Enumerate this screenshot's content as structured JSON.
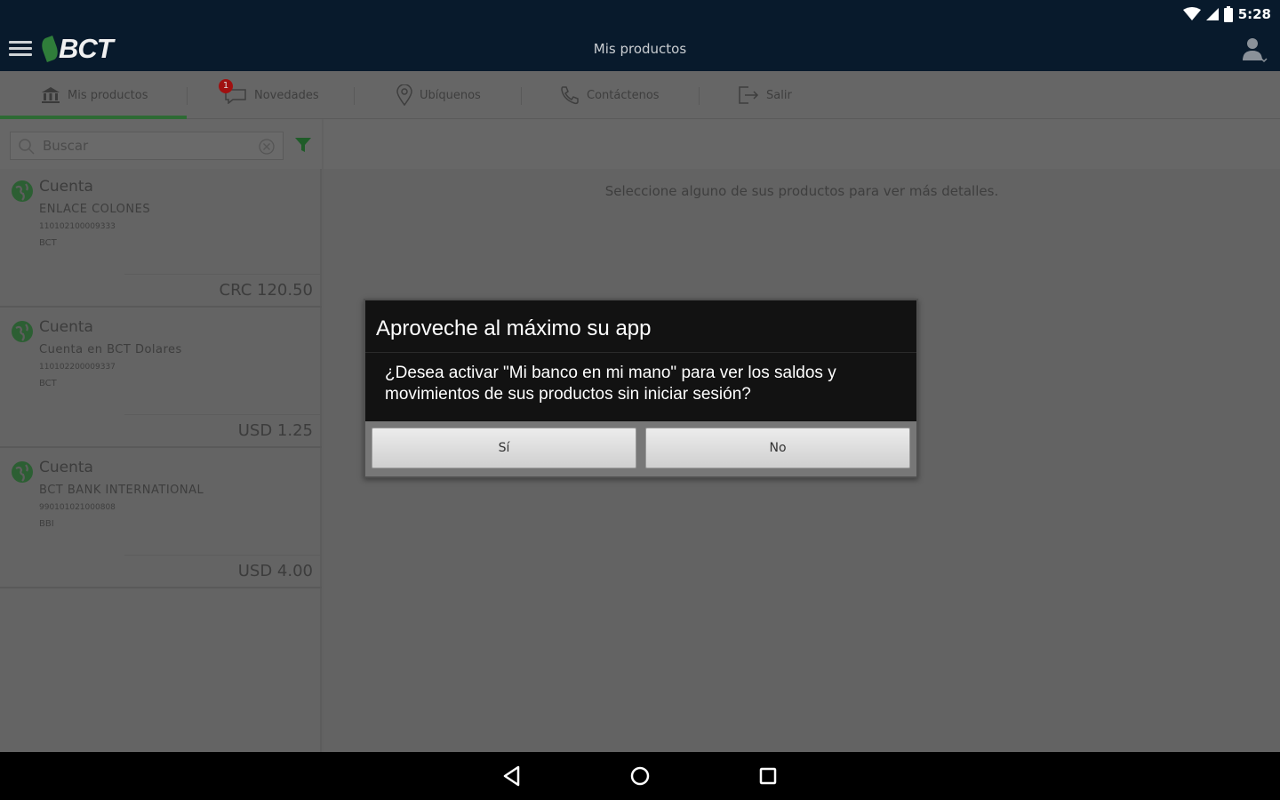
{
  "status_bar": {
    "time": "5:28"
  },
  "app_bar": {
    "logo_text": "BCT",
    "title": "Mis productos"
  },
  "tabs": [
    {
      "label": "Mis productos",
      "icon": "bank-icon",
      "active": true
    },
    {
      "label": "Novedades",
      "icon": "chat-icon",
      "badge": "1"
    },
    {
      "label": "Ubíquenos",
      "icon": "location-pin-icon"
    },
    {
      "label": "Contáctenos",
      "icon": "phone-icon"
    },
    {
      "label": "Salir",
      "icon": "logout-icon"
    }
  ],
  "search": {
    "placeholder": "Buscar"
  },
  "products": [
    {
      "type": "Cuenta",
      "name": "ENLACE COLONES",
      "number": "110102100009333",
      "bank": "BCT",
      "amount": "CRC 120.50"
    },
    {
      "type": "Cuenta",
      "name": "Cuenta en BCT Dolares",
      "number": "110102200009337",
      "bank": "BCT",
      "amount": "USD 1.25"
    },
    {
      "type": "Cuenta",
      "name": "BCT BANK INTERNATIONAL",
      "number": "990101021000808",
      "bank": "BBI",
      "amount": "USD 4.00"
    }
  ],
  "detail_hint": "Seleccione alguno de sus productos para ver más detalles.",
  "dialog": {
    "title": "Aproveche al máximo su app",
    "message": "¿Desea activar \"Mi banco en mi mano\" para ver los saldos y movimientos de sus productos sin iniciar sesión?",
    "yes_label": "Sí",
    "no_label": "No"
  },
  "colors": {
    "app_bar": "#081a2c",
    "accent_green": "#2d6b34",
    "badge_red": "#a01010"
  }
}
